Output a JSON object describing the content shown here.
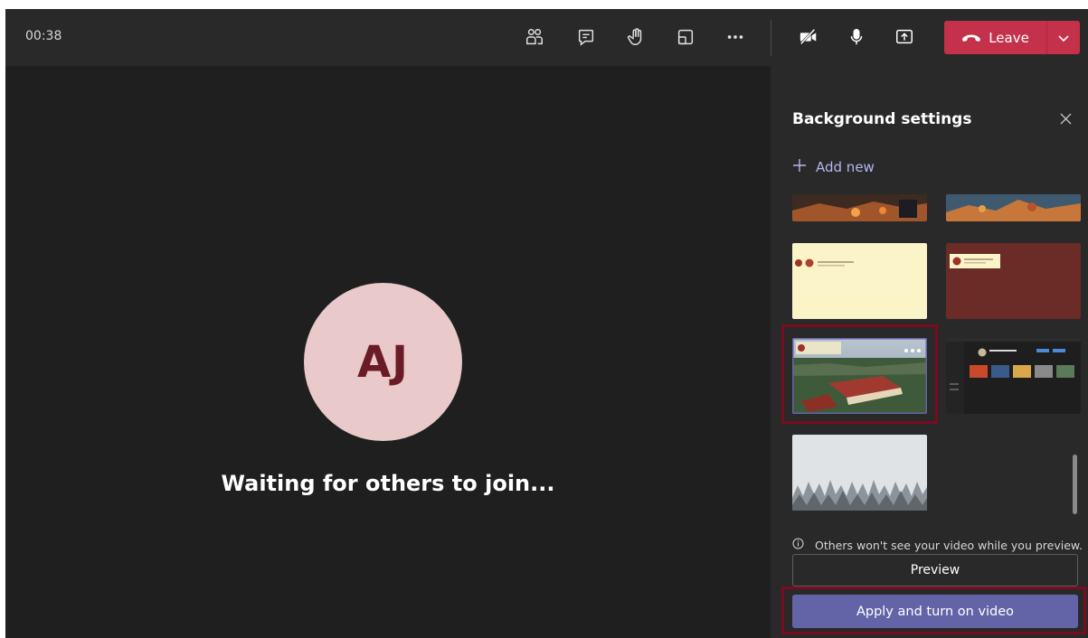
{
  "meeting": {
    "timer": "00:38",
    "avatar_initials": "AJ",
    "waiting_text": "Waiting for others to join..."
  },
  "toolbar": {
    "icons": [
      "people-icon",
      "chat-icon",
      "raise-hand-icon",
      "rooms-icon",
      "more-icon",
      "camera-off-icon",
      "mic-icon",
      "share-icon"
    ],
    "leave_label": "Leave"
  },
  "panel": {
    "title": "Background settings",
    "add_new_label": "Add new",
    "info_text": "Others won't see your video while you preview.",
    "preview_label": "Preview",
    "apply_label": "Apply and turn on video"
  },
  "colors": {
    "accent": "#6264a7",
    "leave": "#c4314b",
    "highlight": "#7a0c21"
  }
}
